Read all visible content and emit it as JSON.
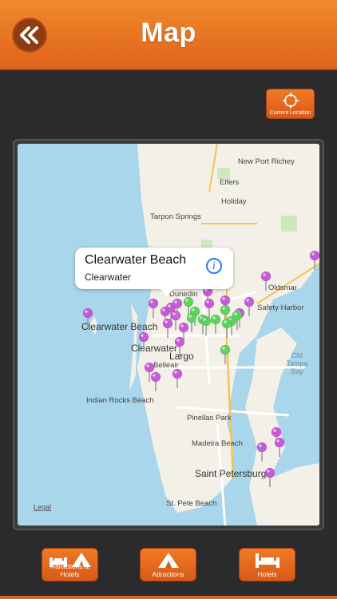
{
  "header": {
    "title": "Map",
    "back_icon": "double-chevron-left-icon"
  },
  "current_location": {
    "label": "Current Location",
    "icon": "crosshair-icon"
  },
  "map": {
    "places": [
      {
        "id": "new-port-richey",
        "name": "New Port Richey"
      },
      {
        "id": "elfers",
        "name": "Elfers"
      },
      {
        "id": "holiday",
        "name": "Holiday"
      },
      {
        "id": "tarpon-springs",
        "name": "Tarpon Springs"
      },
      {
        "id": "oldsmar",
        "name": "Oldsmar"
      },
      {
        "id": "dunedin",
        "name": "Dunedin"
      },
      {
        "id": "safety-harbor",
        "name": "Safety Harbor"
      },
      {
        "id": "clearwater-beach",
        "name": "Clearwater Beach"
      },
      {
        "id": "clearwater",
        "name": "Clearwater"
      },
      {
        "id": "belleair",
        "name": "Belleair"
      },
      {
        "id": "largo",
        "name": "Largo"
      },
      {
        "id": "indian-rocks-beach",
        "name": "Indian Rocks Beach"
      },
      {
        "id": "pinellas-park",
        "name": "Pinellas Park"
      },
      {
        "id": "madeira-beach",
        "name": "Madeira Beach"
      },
      {
        "id": "saint-petersburg",
        "name": "Saint Petersburg"
      },
      {
        "id": "st-pete-beach",
        "name": "St. Pete Beach"
      }
    ],
    "water": {
      "name": "Old Tampa Bay"
    },
    "legal": "Legal",
    "callout": {
      "title": "Clearwater Beach",
      "subtitle": "Clearwater",
      "info_icon": "info-icon"
    },
    "pin_colors": {
      "attraction": "#c65ad8",
      "hotel": "#5cd35c"
    }
  },
  "bottom_bar": {
    "attractions_hotels": {
      "label": "Attractions & Hotels",
      "icon": "bed-and-tent-icon"
    },
    "attractions": {
      "label": "Attractions",
      "icon": "tent-icon"
    },
    "hotels": {
      "label": "Hotels",
      "icon": "bed-icon"
    }
  }
}
